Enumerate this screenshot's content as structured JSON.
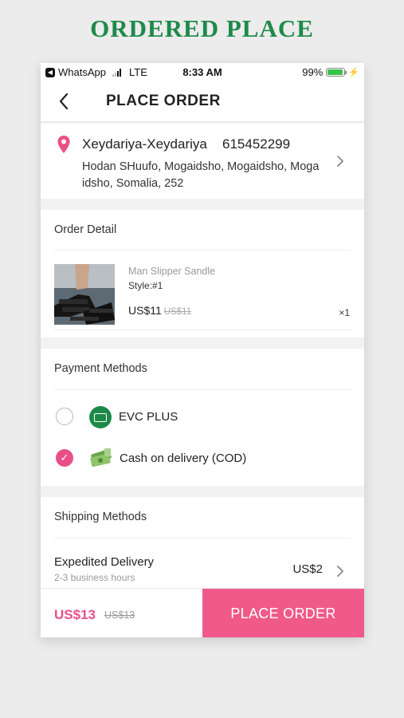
{
  "banner": {
    "title": "ORDERED PLACE"
  },
  "status_bar": {
    "app": "WhatsApp",
    "network": "LTE",
    "time": "8:33 AM",
    "battery": "99%"
  },
  "nav": {
    "title": "PLACE ORDER",
    "back_icon": "chevron-left-icon"
  },
  "address": {
    "name": "Xeydariya-Xeydariya",
    "phone": "615452299",
    "line": "Hodan SHuufo, Mogaidsho, Mogaidsho, Mogaidsho, Somalia, 252"
  },
  "order": {
    "title": "Order Detail",
    "product": {
      "name": "Man Slipper Sandle",
      "style": "Style:#1",
      "price": "US$11",
      "original_price": "US$11",
      "quantity": "×1"
    }
  },
  "payment": {
    "title": "Payment Methods",
    "methods": [
      {
        "label": "EVC PLUS",
        "selected": false,
        "icon": "evc-plus-icon"
      },
      {
        "label": "Cash on delivery (COD)",
        "selected": true,
        "icon": "cash-money-icon"
      }
    ]
  },
  "shipping": {
    "title": "Shipping Methods",
    "method": "Expedited Delivery",
    "time": "2-3 business hours",
    "price": "US$2"
  },
  "footer": {
    "total": "US$13",
    "original_total": "US$13",
    "button": "PLACE ORDER"
  },
  "colors": {
    "accent": "#ef5a8a",
    "price": "#e94f87",
    "banner": "#1e8a4a",
    "evc": "#1e8a4a"
  }
}
